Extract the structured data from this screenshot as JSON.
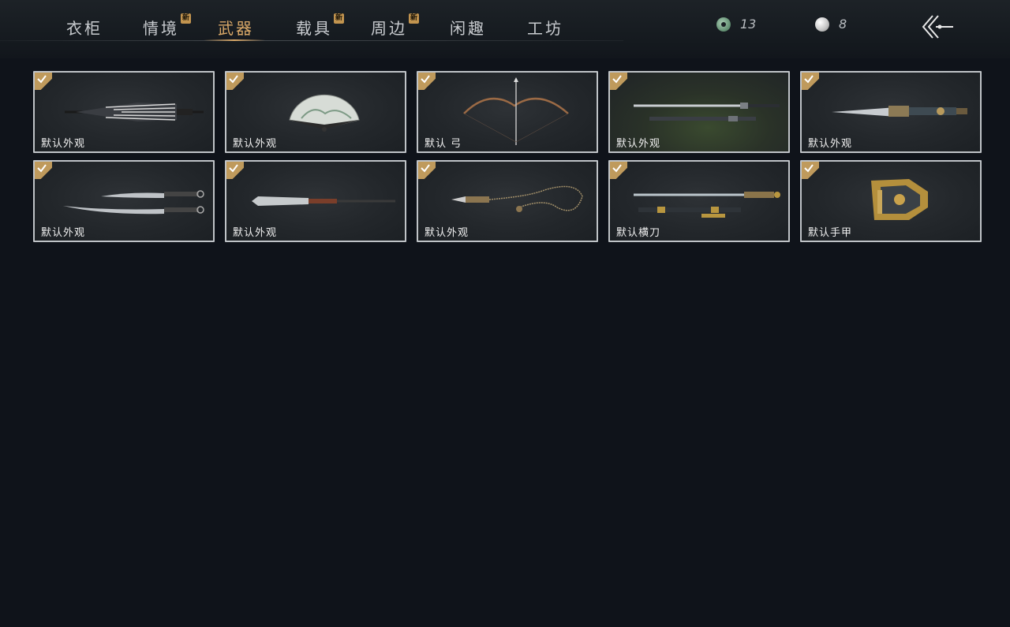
{
  "tabs": [
    {
      "label": "衣柜",
      "is_new": false,
      "active": false
    },
    {
      "label": "情境",
      "is_new": true,
      "active": false
    },
    {
      "label": "武器",
      "is_new": false,
      "active": true
    },
    {
      "label": "载具",
      "is_new": true,
      "active": false
    },
    {
      "label": "周边",
      "is_new": true,
      "active": false
    },
    {
      "label": "闲趣",
      "is_new": false,
      "active": false
    },
    {
      "label": "工坊",
      "is_new": false,
      "active": false
    }
  ],
  "new_badge_text": "新",
  "currencies": [
    {
      "icon": "jade-coin-icon",
      "amount": "13"
    },
    {
      "icon": "pearl-icon",
      "amount": "8"
    }
  ],
  "items": [
    {
      "label": "默认外观",
      "icon": "umbrella-icon",
      "owned": true
    },
    {
      "label": "默认外观",
      "icon": "fan-icon",
      "owned": true
    },
    {
      "label": "默认 弓",
      "icon": "bow-icon",
      "owned": true
    },
    {
      "label": "默认外观",
      "icon": "sword-pair-icon",
      "owned": true
    },
    {
      "label": "默认外观",
      "icon": "ornate-blade-icon",
      "owned": true
    },
    {
      "label": "默认外观",
      "icon": "twin-sabres-icon",
      "owned": true
    },
    {
      "label": "默认外观",
      "icon": "spear-icon",
      "owned": true
    },
    {
      "label": "默认外观",
      "icon": "rope-dart-icon",
      "owned": true
    },
    {
      "label": "默认横刀",
      "icon": "hengdao-icon",
      "owned": true
    },
    {
      "label": "默认手甲",
      "icon": "gauntlet-icon",
      "owned": true
    }
  ],
  "colors": {
    "accent": "#d9a868",
    "check_badge": "#bf9a5c",
    "card_border": "#bfc3c7",
    "background": "#0f131a"
  }
}
